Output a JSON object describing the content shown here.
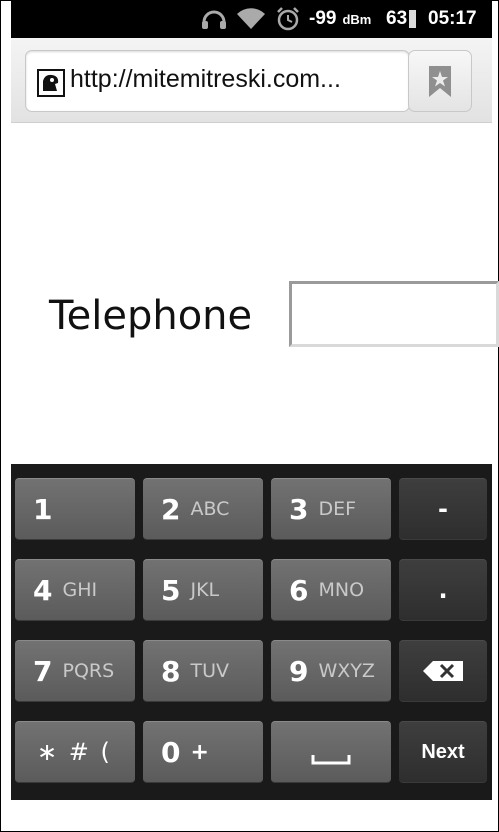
{
  "status_bar": {
    "signal_value": "-99",
    "signal_unit": "dBm",
    "battery_level": "63",
    "time": "05:17"
  },
  "browser": {
    "url": "http://mitemitreski.com..."
  },
  "form": {
    "telephone_label": "Telephone",
    "telephone_value": ""
  },
  "keypad": {
    "rows": [
      [
        {
          "main": "1",
          "sub": ""
        },
        {
          "main": "2",
          "sub": "ABC"
        },
        {
          "main": "3",
          "sub": "DEF"
        },
        {
          "main": "-",
          "sub": ""
        }
      ],
      [
        {
          "main": "4",
          "sub": "GHI"
        },
        {
          "main": "5",
          "sub": "JKL"
        },
        {
          "main": "6",
          "sub": "MNO"
        },
        {
          "main": ".",
          "sub": ""
        }
      ],
      [
        {
          "main": "7",
          "sub": "PQRS"
        },
        {
          "main": "8",
          "sub": "TUV"
        },
        {
          "main": "9",
          "sub": "WXYZ"
        },
        {
          "main": "",
          "sub": ""
        }
      ],
      [
        {
          "main": "∗ # (",
          "sub": ""
        },
        {
          "main": "0",
          "sub": "+"
        },
        {
          "main": "",
          "sub": ""
        },
        {
          "main": "Next",
          "sub": ""
        }
      ]
    ]
  },
  "icons": {
    "headphones": "headphones-icon",
    "wifi": "wifi-icon",
    "alarm": "alarm-clock-icon",
    "battery": "battery-icon",
    "favicon": "site-favicon-icon",
    "bookmark": "bookmark-icon",
    "backspace": "backspace-icon",
    "space": "space-bar-icon"
  }
}
